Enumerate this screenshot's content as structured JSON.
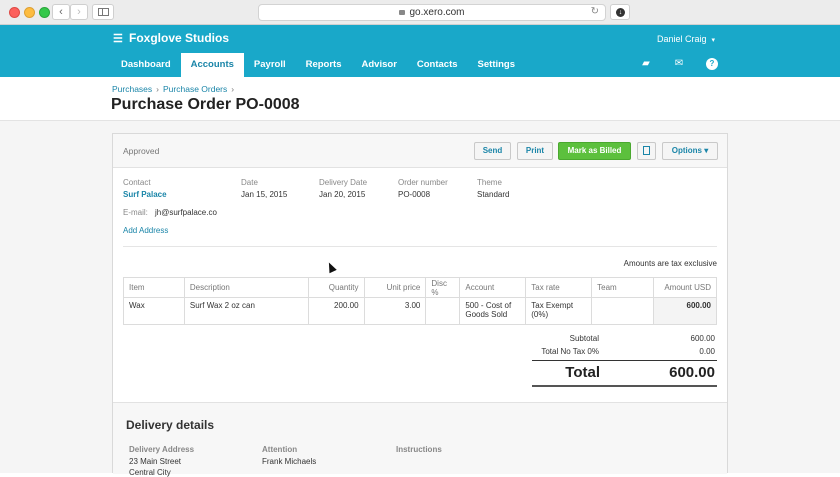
{
  "browser": {
    "url": "go.xero.com",
    "back_glyph": "‹",
    "forward_glyph": "›",
    "reload_glyph": "↻",
    "download_glyph": "↓"
  },
  "header": {
    "org_name": "Foxglove Studios",
    "org_icon": "☰",
    "user_name": "Daniel Craig",
    "user_caret": "▾",
    "tabs": [
      {
        "label": "Dashboard",
        "active": false
      },
      {
        "label": "Accounts",
        "active": true
      },
      {
        "label": "Payroll",
        "active": false
      },
      {
        "label": "Reports",
        "active": false
      },
      {
        "label": "Advisor",
        "active": false
      },
      {
        "label": "Contacts",
        "active": false
      },
      {
        "label": "Settings",
        "active": false
      }
    ],
    "icons": {
      "files": "▰",
      "mail": "✉",
      "help": "?"
    }
  },
  "breadcrumb": {
    "items": [
      "Purchases",
      "Purchase Orders"
    ],
    "sep": "›"
  },
  "page_title": "Purchase Order PO-0008",
  "toolbar": {
    "status": "Approved",
    "send": "Send",
    "print": "Print",
    "mark_billed": "Mark as Billed",
    "options": "Options ▾"
  },
  "details": {
    "contact_label": "Contact",
    "contact_value": "Surf Palace",
    "date_label": "Date",
    "date_value": "Jan 15, 2015",
    "delivery_date_label": "Delivery Date",
    "delivery_date_value": "Jan 20, 2015",
    "order_number_label": "Order number",
    "order_number_value": "PO-0008",
    "theme_label": "Theme",
    "theme_value": "Standard",
    "email_label": "E-mail:",
    "email_value": "jh@surfpalace.co",
    "add_address": "Add Address"
  },
  "tax_note": "Amounts are tax exclusive",
  "line_items": {
    "headers": [
      "Item",
      "Description",
      "Quantity",
      "Unit price",
      "Disc %",
      "Account",
      "Tax rate",
      "Team",
      "Amount USD"
    ],
    "rows": [
      {
        "item": "Wax",
        "description": "Surf Wax 2 oz can",
        "quantity": "200.00",
        "unit_price": "3.00",
        "disc": "",
        "account_line1": "500 - Cost of",
        "account_line2": "Goods Sold",
        "tax_line1": "Tax Exempt",
        "tax_line2": "(0%)",
        "team": "",
        "amount": "600.00"
      }
    ]
  },
  "totals": {
    "subtotal_label": "Subtotal",
    "subtotal_value": "600.00",
    "tax_label": "Total No Tax 0%",
    "tax_value": "0.00",
    "total_label": "Total",
    "total_value": "600.00"
  },
  "delivery": {
    "title": "Delivery details",
    "address_label": "Delivery Address",
    "address_line1": "23 Main Street",
    "address_line2": "Central City",
    "attention_label": "Attention",
    "attention_value": "Frank Michaels",
    "instructions_label": "Instructions"
  }
}
